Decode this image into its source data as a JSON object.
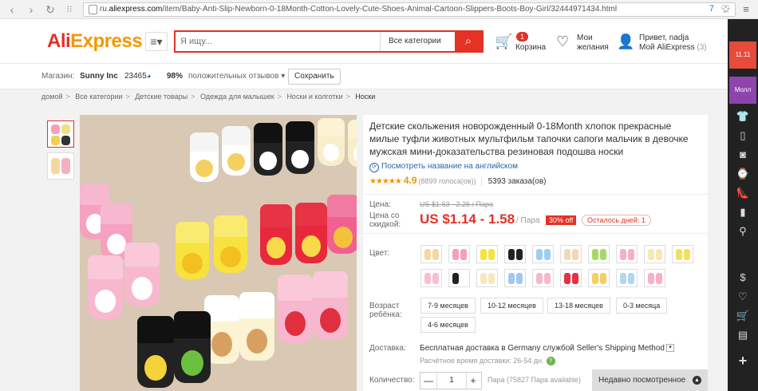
{
  "browser": {
    "back_icon": "back-arrow-icon",
    "url_prefix": "ru.",
    "url_domain": "aliexpress.com",
    "url_path": "/item/Baby-Anti-Slip-Newborn-0-18Month-Cotton-Lovely-Cute-Shoes-Animal-Cartoon-Slippers-Boots-Boy-Girl/32444971434.html",
    "shield_count": "7"
  },
  "header": {
    "logo_ali": "Ali",
    "logo_express": "Express",
    "search_placeholder": "Я ищу...",
    "search_category": "Все категории",
    "cart_count": "1",
    "cart_label": "Корзина",
    "wish_line1": "Мои",
    "wish_line2": "желания",
    "user_line1": "Привет, nadja",
    "user_line2": "Мой AliExpress",
    "user_count": "(3)"
  },
  "store": {
    "label": "Магазин:",
    "name": "Sunny Inc",
    "score": "23465",
    "positive": "98%",
    "positive_label": "положительных отзывов",
    "save": "Сохранить"
  },
  "breadcrumbs": [
    "домой",
    "Все категории",
    "Детские товары",
    "Одежда для малышек",
    "Носки и колготки",
    "Носки"
  ],
  "product": {
    "title": "Детские скольжения новорожденный 0-18Month хлопок прекрасные милые туфли животных мультфильм тапочки сапоги мальчик в девочке мужская мини-доказательства резиновая подошва носки",
    "translate": "Посмотреть название на английском",
    "stars": "★★★★★",
    "rating": "4.9",
    "votes": "(8899 голоса(ов))",
    "orders": "5393 заказа(ов)",
    "price_label": "Цена:",
    "old_price": "US $1.63 - 2.26 / Пара",
    "discount_label_1": "Цена со",
    "discount_label_2": "скидкой:",
    "new_price": "US $1.14 - 1.58",
    "unit": "/ Пара",
    "discount": "30% off",
    "days_left": "Осталось дней: 1",
    "color_label": "Цвет:",
    "age_label_1": "Возраст",
    "age_label_2": "ребёнка:",
    "sizes": [
      "7-9 месяцев",
      "10-12 месяцев",
      "13-18 месяцев",
      "0-3 месяца",
      "4-6 месяцев"
    ],
    "shipping_label": "Доставка:",
    "shipping_text": "Бесплатная доставка",
    "shipping_in": "в",
    "shipping_country": "Germany",
    "shipping_service": "службой Seller's Shipping Method",
    "shipping_time": "Расчётное время доставки: 26-54 дн.",
    "qty_label": "Количество:",
    "qty_value": "1",
    "qty_minus": "—",
    "qty_plus": "+",
    "available": "Пара (75827 Пара available)"
  },
  "recent": "Недавно посмотренное",
  "sidebar": {
    "promo1": "11.11",
    "promo2": "Молл"
  },
  "colors": {
    "accent": "#e43225",
    "orange": "#f39800",
    "link": "#2b63a9"
  }
}
